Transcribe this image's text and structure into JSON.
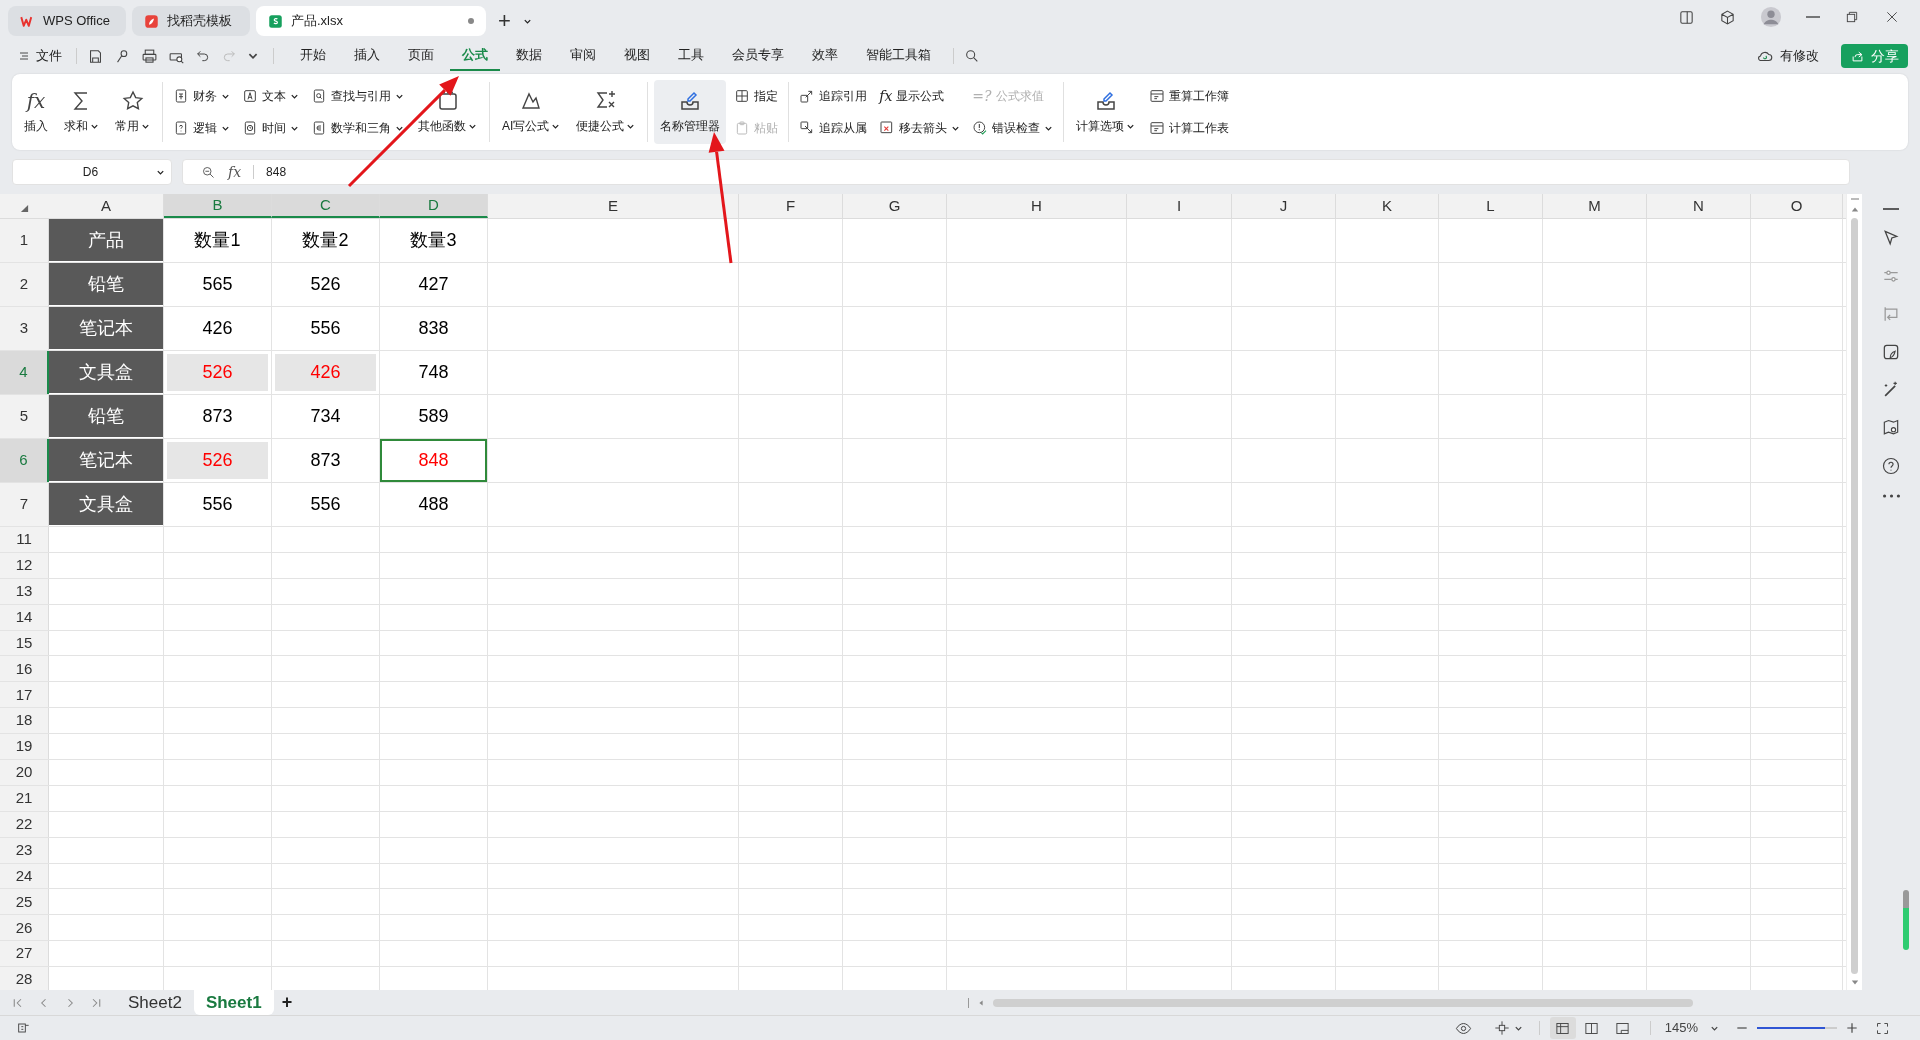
{
  "title_tabs": [
    {
      "label": "WPS Office",
      "selected": false,
      "unsaved": false
    },
    {
      "label": "找稻壳模板",
      "selected": false,
      "unsaved": false
    },
    {
      "label": "产品.xlsx",
      "selected": true,
      "unsaved": true
    }
  ],
  "new_tab": "+",
  "menu": {
    "file": "文件",
    "tabs": [
      {
        "label": "开始",
        "selected": false
      },
      {
        "label": "插入",
        "selected": false
      },
      {
        "label": "页面",
        "selected": false
      },
      {
        "label": "公式",
        "selected": true
      },
      {
        "label": "数据",
        "selected": false
      },
      {
        "label": "审阅",
        "selected": false
      },
      {
        "label": "视图",
        "selected": false
      },
      {
        "label": "工具",
        "selected": false
      },
      {
        "label": "会员专享",
        "selected": false
      },
      {
        "label": "效率",
        "selected": false
      },
      {
        "label": "智能工具箱",
        "selected": false
      }
    ]
  },
  "cloud_status": "有修改",
  "share": "分享",
  "ribbon": [
    [
      {
        "kind": "large",
        "label": "插入",
        "glyph": "fx",
        "dropdown": false,
        "disabled": false,
        "highlighted": false
      },
      {
        "kind": "large",
        "label": "求和",
        "dropdown": true,
        "disabled": false,
        "highlighted": false
      },
      {
        "kind": "large",
        "label": "常用",
        "dropdown": true,
        "disabled": false,
        "highlighted": false
      }
    ],
    [
      {
        "kind": "pair",
        "items": [
          {
            "label": "财务",
            "dropdown": true,
            "disabled": false
          },
          {
            "label": "逻辑",
            "dropdown": true,
            "disabled": false
          }
        ]
      },
      {
        "kind": "pair",
        "items": [
          {
            "label": "文本",
            "dropdown": true,
            "disabled": false
          },
          {
            "label": "时间",
            "dropdown": true,
            "disabled": false
          }
        ]
      },
      {
        "kind": "pair",
        "items": [
          {
            "label": "查找与引用",
            "dropdown": true,
            "disabled": false
          },
          {
            "label": "数学和三角",
            "dropdown": true,
            "disabled": false
          }
        ]
      },
      {
        "kind": "large",
        "label": "其他函数",
        "dropdown": true,
        "disabled": false,
        "highlighted": false
      }
    ],
    [
      {
        "kind": "large",
        "label": "AI写公式",
        "dropdown": true,
        "disabled": false,
        "highlighted": false
      },
      {
        "kind": "large",
        "label": "便捷公式",
        "dropdown": true,
        "disabled": false,
        "highlighted": false
      }
    ],
    [
      {
        "kind": "large",
        "label": "名称管理器",
        "dropdown": false,
        "disabled": false,
        "highlighted": true
      },
      {
        "kind": "pair",
        "items": [
          {
            "label": "指定",
            "dropdown": false,
            "disabled": false
          },
          {
            "label": "粘贴",
            "dropdown": false,
            "disabled": true
          }
        ]
      }
    ],
    [
      {
        "kind": "pair",
        "items": [
          {
            "label": "追踪引用",
            "dropdown": false,
            "disabled": false
          },
          {
            "label": "追踪从属",
            "dropdown": false,
            "disabled": false
          }
        ]
      },
      {
        "kind": "pair",
        "items": [
          {
            "label": "显示公式",
            "glyph": "fx",
            "dropdown": false,
            "disabled": false
          },
          {
            "label": "移去箭头",
            "dropdown": true,
            "disabled": false
          }
        ]
      },
      {
        "kind": "pair",
        "items": [
          {
            "label": "公式求值",
            "glyph": "=?",
            "dropdown": false,
            "disabled": true
          },
          {
            "label": "错误检查",
            "dropdown": true,
            "disabled": false
          }
        ]
      }
    ],
    [
      {
        "kind": "large",
        "label": "计算选项",
        "dropdown": true,
        "disabled": false,
        "highlighted": false
      },
      {
        "kind": "pair",
        "items": [
          {
            "label": "重算工作簿",
            "dropdown": false,
            "disabled": false
          },
          {
            "label": "计算工作表",
            "dropdown": false,
            "disabled": false
          }
        ]
      }
    ]
  ],
  "formula_bar": {
    "cell": "D6",
    "fx": "fx",
    "value": "848"
  },
  "columns": [
    {
      "label": "A",
      "selected": false
    },
    {
      "label": "B",
      "selected": true
    },
    {
      "label": "C",
      "selected": true
    },
    {
      "label": "D",
      "selected": true
    },
    {
      "label": "E",
      "selected": false
    },
    {
      "label": "F",
      "selected": false
    },
    {
      "label": "G",
      "selected": false
    },
    {
      "label": "H",
      "selected": false
    },
    {
      "label": "I",
      "selected": false
    },
    {
      "label": "J",
      "selected": false
    },
    {
      "label": "K",
      "selected": false
    },
    {
      "label": "L",
      "selected": false
    },
    {
      "label": "M",
      "selected": false
    },
    {
      "label": "N",
      "selected": false
    },
    {
      "label": "O",
      "selected": false
    }
  ],
  "rows": [
    {
      "label": "1",
      "selected": false,
      "cells": [
        {
          "kind": "label",
          "text": "产品",
          "selected": false,
          "shaded": false,
          "red": false
        },
        {
          "kind": "value",
          "text": "数量1",
          "selected": false,
          "shaded": false,
          "red": false
        },
        {
          "kind": "value",
          "text": "数量2",
          "selected": false,
          "shaded": false,
          "red": false
        },
        {
          "kind": "value",
          "text": "数量3",
          "selected": false,
          "shaded": false,
          "red": false
        }
      ]
    },
    {
      "label": "2",
      "selected": false,
      "cells": [
        {
          "kind": "label",
          "text": "铅笔",
          "selected": false,
          "shaded": false,
          "red": false
        },
        {
          "kind": "value",
          "text": "565",
          "selected": false,
          "shaded": false,
          "red": false
        },
        {
          "kind": "value",
          "text": "526",
          "selected": false,
          "shaded": false,
          "red": false
        },
        {
          "kind": "value",
          "text": "427",
          "selected": false,
          "shaded": false,
          "red": false
        }
      ]
    },
    {
      "label": "3",
      "selected": false,
      "cells": [
        {
          "kind": "label",
          "text": "笔记本",
          "selected": false,
          "shaded": false,
          "red": false
        },
        {
          "kind": "value",
          "text": "426",
          "selected": false,
          "shaded": false,
          "red": false
        },
        {
          "kind": "value",
          "text": "556",
          "selected": false,
          "shaded": false,
          "red": false
        },
        {
          "kind": "value",
          "text": "838",
          "selected": false,
          "shaded": false,
          "red": false
        }
      ]
    },
    {
      "label": "4",
      "selected": true,
      "cells": [
        {
          "kind": "label",
          "text": "文具盒",
          "selected": false,
          "shaded": false,
          "red": false
        },
        {
          "kind": "value",
          "text": "526",
          "selected": false,
          "shaded": true,
          "red": true
        },
        {
          "kind": "value",
          "text": "426",
          "selected": false,
          "shaded": true,
          "red": true
        },
        {
          "kind": "value",
          "text": "748",
          "selected": false,
          "shaded": false,
          "red": false
        }
      ]
    },
    {
      "label": "5",
      "selected": false,
      "cells": [
        {
          "kind": "label",
          "text": "铅笔",
          "selected": false,
          "shaded": false,
          "red": false
        },
        {
          "kind": "value",
          "text": "873",
          "selected": false,
          "shaded": false,
          "red": false
        },
        {
          "kind": "value",
          "text": "734",
          "selected": false,
          "shaded": false,
          "red": false
        },
        {
          "kind": "value",
          "text": "589",
          "selected": false,
          "shaded": false,
          "red": false
        }
      ]
    },
    {
      "label": "6",
      "selected": true,
      "cells": [
        {
          "kind": "label",
          "text": "笔记本",
          "selected": false,
          "shaded": false,
          "red": false
        },
        {
          "kind": "value",
          "text": "526",
          "selected": false,
          "shaded": true,
          "red": true
        },
        {
          "kind": "value",
          "text": "873",
          "selected": false,
          "shaded": false,
          "red": false
        },
        {
          "kind": "value",
          "text": "848",
          "selected": true,
          "shaded": false,
          "red": true
        }
      ]
    },
    {
      "label": "7",
      "selected": false,
      "cells": [
        {
          "kind": "label",
          "text": "文具盒",
          "selected": false,
          "shaded": false,
          "red": false
        },
        {
          "kind": "value",
          "text": "556",
          "selected": false,
          "shaded": false,
          "red": false
        },
        {
          "kind": "value",
          "text": "556",
          "selected": false,
          "shaded": false,
          "red": false
        },
        {
          "kind": "value",
          "text": "488",
          "selected": false,
          "shaded": false,
          "red": false
        }
      ]
    },
    {
      "label": "11",
      "selected": false
    },
    {
      "label": "12",
      "selected": false
    },
    {
      "label": "13",
      "selected": false
    },
    {
      "label": "14",
      "selected": false
    },
    {
      "label": "15",
      "selected": false
    },
    {
      "label": "16",
      "selected": false
    },
    {
      "label": "17",
      "selected": false
    },
    {
      "label": "18",
      "selected": false
    },
    {
      "label": "19",
      "selected": false
    },
    {
      "label": "20",
      "selected": false
    },
    {
      "label": "21",
      "selected": false
    },
    {
      "label": "22",
      "selected": false
    },
    {
      "label": "23",
      "selected": false
    },
    {
      "label": "24",
      "selected": false
    },
    {
      "label": "25",
      "selected": false
    },
    {
      "label": "26",
      "selected": false
    },
    {
      "label": "27",
      "selected": false
    },
    {
      "label": "28",
      "selected": false
    }
  ],
  "sheets": [
    {
      "label": "Sheet2",
      "selected": false
    },
    {
      "label": "Sheet1",
      "selected": true
    }
  ],
  "add_sheet": "+",
  "status_bar": {
    "zoom": "145%",
    "zoom_slider": {
      "level": 0.85
    }
  },
  "annotations": [
    {
      "kind": "arrow"
    },
    {
      "kind": "arrow"
    }
  ]
}
